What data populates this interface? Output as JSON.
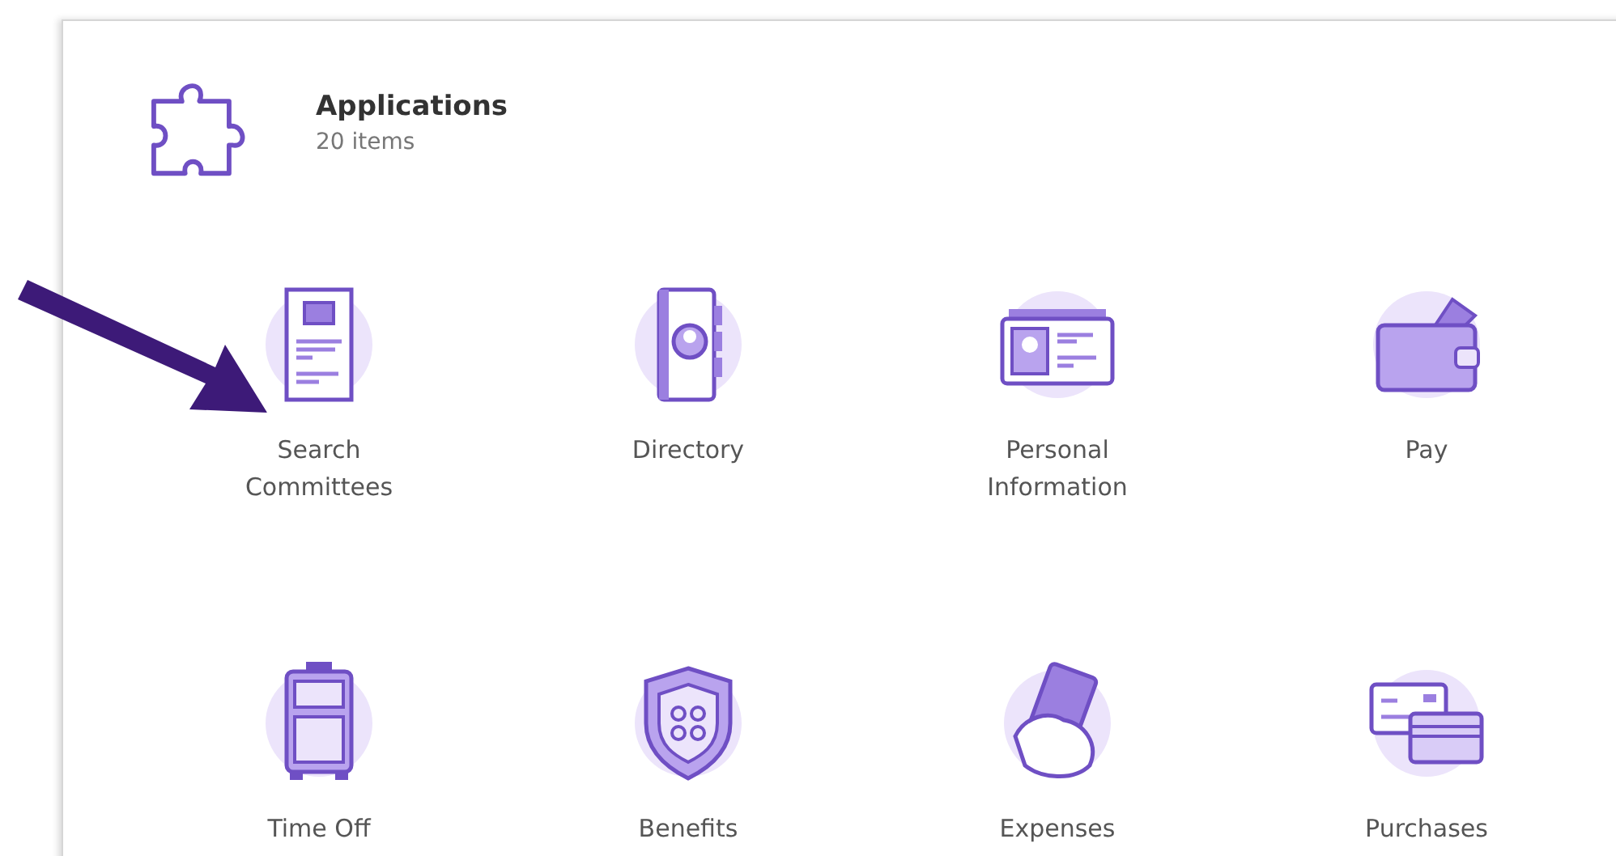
{
  "header": {
    "title": "Applications",
    "count": "20 items"
  },
  "apps": [
    {
      "kind": "document",
      "label": "Search Committees"
    },
    {
      "kind": "directory",
      "label": "Directory"
    },
    {
      "kind": "idcard",
      "label": "Personal Information"
    },
    {
      "kind": "wallet",
      "label": "Pay"
    },
    {
      "kind": "suitcase",
      "label": "Time Off"
    },
    {
      "kind": "shield",
      "label": "Benefits"
    },
    {
      "kind": "cash",
      "label": "Expenses"
    },
    {
      "kind": "cards",
      "label": "Purchases"
    }
  ]
}
